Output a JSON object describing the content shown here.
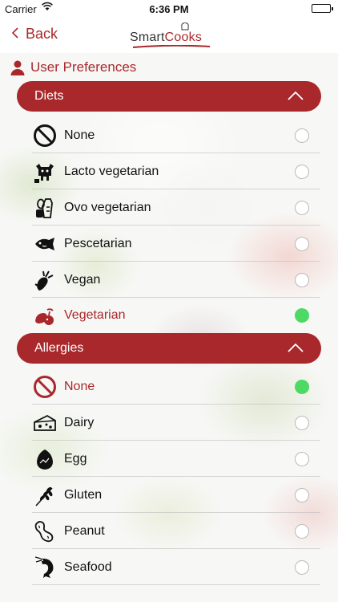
{
  "status_bar": {
    "carrier": "Carrier",
    "time": "6:36 PM"
  },
  "nav": {
    "back_label": "Back",
    "logo_prefix": "Smart",
    "logo_suffix": "Cooks"
  },
  "section": {
    "title": "User Preferences"
  },
  "groups": [
    {
      "title": "Diets",
      "expanded": true,
      "items": [
        {
          "label": "None",
          "icon": "no-entry-icon",
          "selected": false
        },
        {
          "label": "Lacto vegetarian",
          "icon": "cow-icon",
          "selected": false
        },
        {
          "label": "Ovo vegetarian",
          "icon": "eggs-basket-icon",
          "selected": false
        },
        {
          "label": "Pescetarian",
          "icon": "fish-icon",
          "selected": false
        },
        {
          "label": "Vegan",
          "icon": "eggplant-icon",
          "selected": false
        },
        {
          "label": "Vegetarian",
          "icon": "vegetables-icon",
          "selected": true
        }
      ]
    },
    {
      "title": "Allergies",
      "expanded": true,
      "items": [
        {
          "label": "None",
          "icon": "no-entry-icon",
          "selected": true
        },
        {
          "label": "Dairy",
          "icon": "cheese-icon",
          "selected": false
        },
        {
          "label": "Egg",
          "icon": "egg-icon",
          "selected": false
        },
        {
          "label": "Gluten",
          "icon": "wheat-icon",
          "selected": false
        },
        {
          "label": "Peanut",
          "icon": "peanut-icon",
          "selected": false
        },
        {
          "label": "Seafood",
          "icon": "shrimp-icon",
          "selected": false
        }
      ]
    }
  ],
  "colors": {
    "accent": "#a9282b",
    "selected_radio": "#4cd964"
  }
}
